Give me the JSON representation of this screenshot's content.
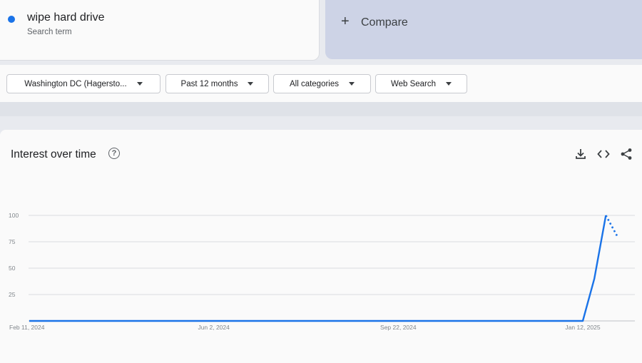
{
  "search_term": {
    "name": "wipe hard drive",
    "type_label": "Search term",
    "color": "#1a73e8"
  },
  "compare": {
    "plus": "+",
    "label": "Compare"
  },
  "filters": {
    "region": "Washington DC (Hagersto...",
    "time_range": "Past 12 months",
    "category": "All categories",
    "search_type": "Web Search"
  },
  "chart_panel": {
    "title": "Interest over time",
    "help_icon": "?",
    "toolbar_icons": [
      "download-icon",
      "embed-code-icon",
      "share-icon"
    ]
  },
  "chart_data": {
    "type": "line",
    "title": "Interest over time",
    "x_tick_labels": [
      "Feb 11, 2024",
      "Jun 2, 2024",
      "Sep 22, 2024",
      "Jan 12, 2025"
    ],
    "y_tick_labels": [
      "100",
      "75",
      "50",
      "25"
    ],
    "ylim": [
      0,
      100
    ],
    "grid": true,
    "series": [
      {
        "color": "#1a73e8",
        "x": [
          "2024-02-11",
          "2025-01-12",
          "2025-01-19",
          "2025-01-26",
          "2025-02-02"
        ],
        "y": [
          0,
          0,
          40,
          100,
          80
        ],
        "partial_last_point": true
      }
    ]
  }
}
